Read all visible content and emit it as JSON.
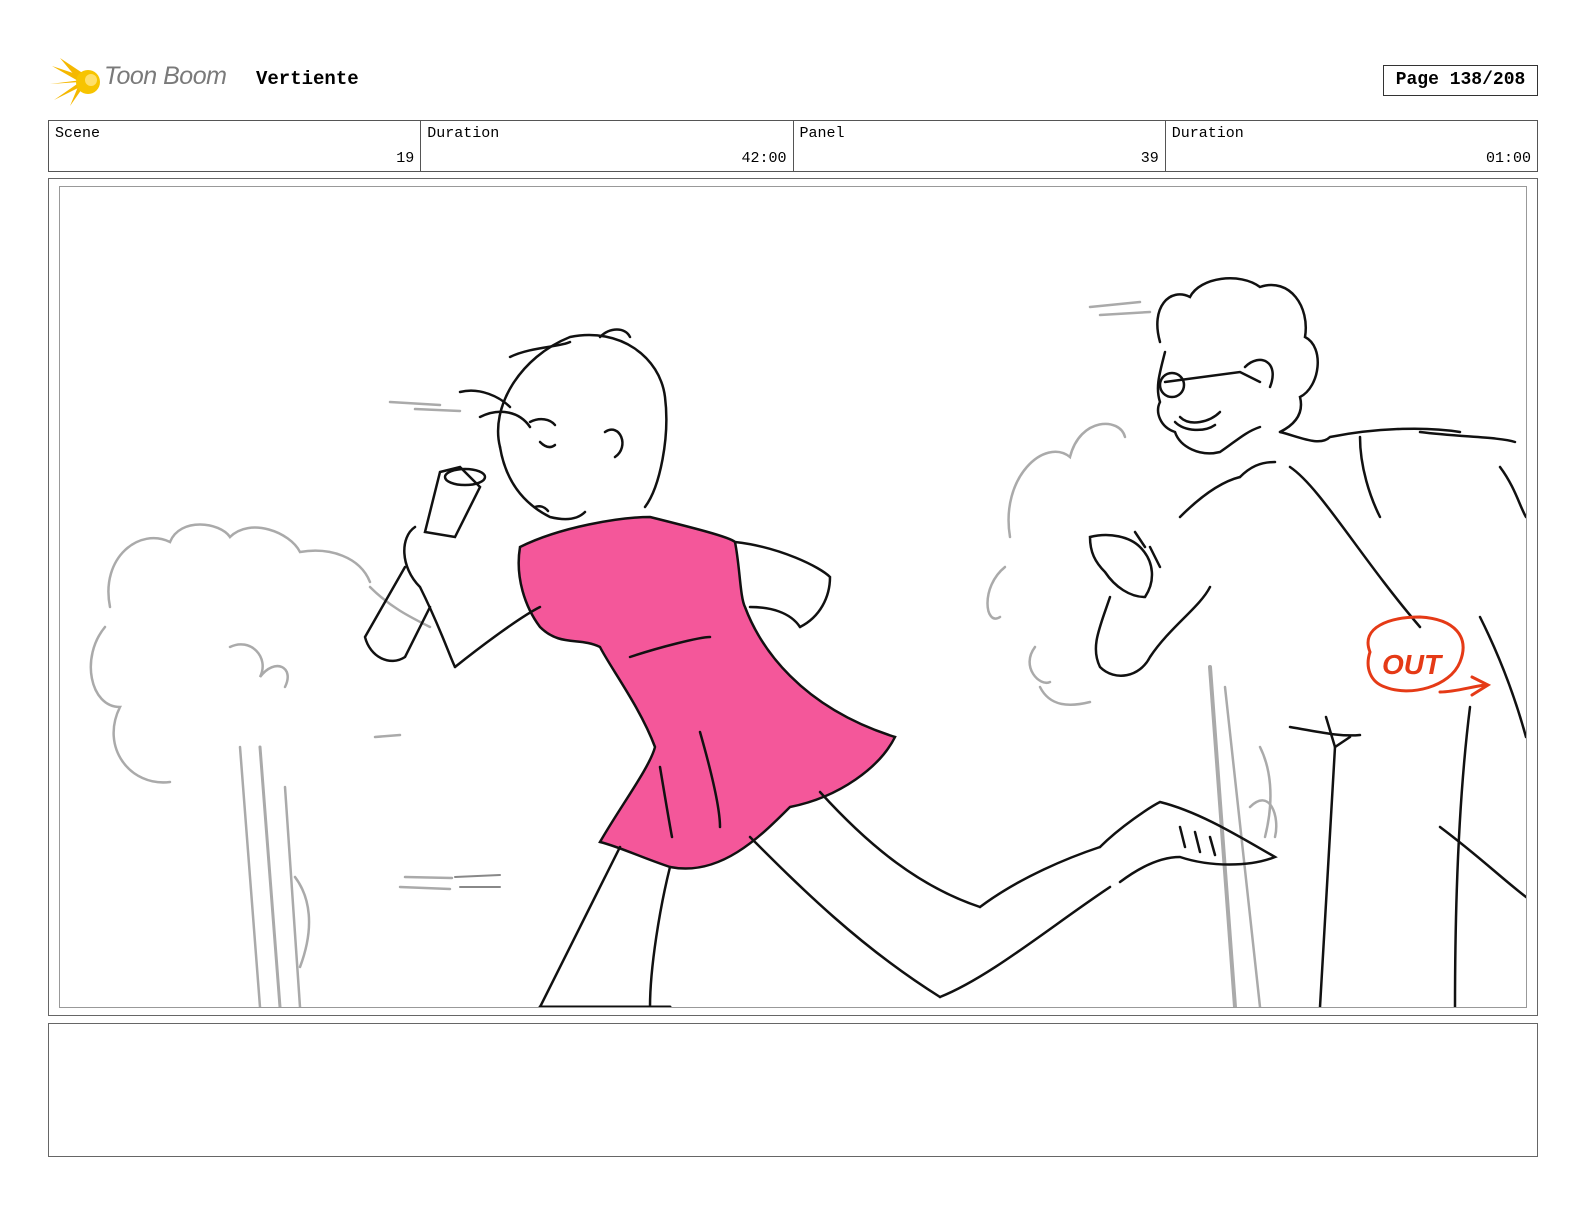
{
  "header": {
    "brand": "Toon Boom",
    "project_title": "Vertiente",
    "page_label": "Page 138/208"
  },
  "info": [
    {
      "label": "Scene",
      "value": "19"
    },
    {
      "label": "Duration",
      "value": "42:00"
    },
    {
      "label": "Panel",
      "value": "39"
    },
    {
      "label": "Duration",
      "value": "01:00"
    }
  ],
  "panel": {
    "annotation": "OUT",
    "colors": {
      "dress": "#f4579a",
      "annotation": "#e53a16",
      "background_sketch": "#aaaaaa",
      "line": "#111111",
      "logo_star": "#f5b800"
    }
  },
  "notes": {
    "text": ""
  }
}
